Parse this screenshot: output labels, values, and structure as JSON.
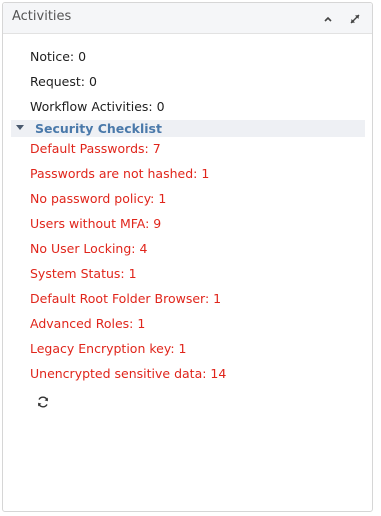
{
  "panel": {
    "title": "Activities",
    "collapse_icon": "chevron-up-icon",
    "expand_icon": "expand-arrows-icon"
  },
  "counts": [
    {
      "label": "Notice: 0"
    },
    {
      "label": "Request: 0"
    },
    {
      "label": "Workflow Activities: 0"
    }
  ],
  "security_checklist": {
    "title": "Security Checklist",
    "caret_icon": "caret-down-icon",
    "items": [
      {
        "label": "Default Passwords: 7"
      },
      {
        "label": "Passwords are not hashed: 1"
      },
      {
        "label": "No password policy: 1"
      },
      {
        "label": "Users without MFA: 9"
      },
      {
        "label": "No User Locking: 4"
      },
      {
        "label": "System Status: 1"
      },
      {
        "label": "Default Root Folder Browser: 1"
      },
      {
        "label": "Advanced Roles: 1"
      },
      {
        "label": "Legacy Encryption key: 1"
      },
      {
        "label": "Unencrypted sensitive data: 14"
      }
    ]
  },
  "refresh_icon": "refresh-icon",
  "colors": {
    "alert_text": "#e0251b",
    "section_title": "#4a79aa",
    "normal_text": "#1e1e1e"
  }
}
